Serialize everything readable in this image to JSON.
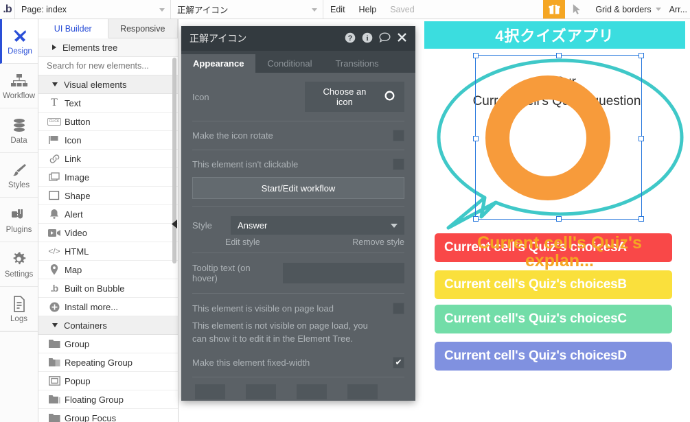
{
  "topbar": {
    "logo": "bubble-logo",
    "page_selector": "Page: index",
    "element_selector": "正解アイコン",
    "edit": "Edit",
    "help": "Help",
    "saved": "Saved",
    "gift_icon": "gift-icon",
    "cursor_icon": "cursor-arrow-icon",
    "grid_borders": "Grid & borders",
    "arrange": "Arr..."
  },
  "rail": {
    "items": [
      {
        "label": "Design",
        "icon": "design-icon",
        "active": true
      },
      {
        "label": "Workflow",
        "icon": "workflow-icon",
        "active": false
      },
      {
        "label": "Data",
        "icon": "database-icon",
        "active": false
      },
      {
        "label": "Styles",
        "icon": "brush-icon",
        "active": false
      },
      {
        "label": "Plugins",
        "icon": "plug-icon",
        "active": false
      },
      {
        "label": "Settings",
        "icon": "gear-icon",
        "active": false
      },
      {
        "label": "Logs",
        "icon": "document-icon",
        "active": false
      }
    ]
  },
  "elements_panel": {
    "tabs": [
      {
        "label": "UI Builder",
        "active": true
      },
      {
        "label": "Responsive",
        "active": false
      }
    ],
    "elements_tree": "Elements tree",
    "search_placeholder": "Search for new elements...",
    "search_value": "",
    "groups": [
      {
        "label": "Visual elements",
        "items": [
          {
            "label": "Text",
            "icon": "text-icon"
          },
          {
            "label": "Button",
            "icon": "button-icon"
          },
          {
            "label": "Icon",
            "icon": "flag-icon"
          },
          {
            "label": "Link",
            "icon": "link-icon"
          },
          {
            "label": "Image",
            "icon": "image-icon"
          },
          {
            "label": "Shape",
            "icon": "shape-icon"
          },
          {
            "label": "Alert",
            "icon": "bell-icon"
          },
          {
            "label": "Video",
            "icon": "video-icon"
          },
          {
            "label": "HTML",
            "icon": "code-icon"
          },
          {
            "label": "Map",
            "icon": "map-pin-icon"
          },
          {
            "label": "Built on Bubble",
            "icon": "bubble-icon"
          },
          {
            "label": "Install more...",
            "icon": "plus-circle-icon"
          }
        ]
      },
      {
        "label": "Containers",
        "items": [
          {
            "label": "Group",
            "icon": "folder-icon"
          },
          {
            "label": "Repeating Group",
            "icon": "folders-icon"
          },
          {
            "label": "Popup",
            "icon": "popup-icon"
          },
          {
            "label": "Floating Group",
            "icon": "floating-group-icon"
          },
          {
            "label": "Group Focus",
            "icon": "group-focus-icon"
          }
        ]
      }
    ]
  },
  "property_panel": {
    "title": "正解アイコン",
    "header_icons": [
      "help-circle-icon",
      "info-circle-icon",
      "comment-icon",
      "close-icon"
    ],
    "tabs": [
      {
        "label": "Appearance",
        "active": true
      },
      {
        "label": "Conditional",
        "active": false
      },
      {
        "label": "Transitions",
        "active": false
      }
    ],
    "icon_label": "Icon",
    "choose_icon_button": "Choose an icon",
    "choose_icon_glyph": "circle-o-icon",
    "rotate_label": "Make the icon rotate",
    "rotate_checked": false,
    "not_clickable_label": "This element isn't clickable",
    "not_clickable_checked": false,
    "workflow_button": "Start/Edit workflow",
    "style_label": "Style",
    "style_value": "Answer",
    "edit_style": "Edit style",
    "remove_style": "Remove style",
    "tooltip_label": "Tooltip text (on hover)",
    "tooltip_value": "",
    "visible_label": "This element is visible on page load",
    "visible_checked": false,
    "visible_note": "This element is not visible on page load, you can show it to edit it in the Element Tree.",
    "fixed_width_label": "Make this element fixed-width",
    "fixed_width_checked": true
  },
  "canvas": {
    "app_title": "4択クイズアプリ",
    "header_color": "#3BDDDF",
    "bubble_stroke": "#3FC8C8",
    "question_prefix": "Q. Cur",
    "question_text": "Current cell's Quiz's question",
    "ring_color": "#F79B3B",
    "ring_icon": "circle-o-icon",
    "explanation_text": "Current cell's Quiz's explan...",
    "explanation_color": "#F5A623",
    "choices": [
      {
        "label": "Current cell's Quiz's choicesA",
        "color": "#F94848"
      },
      {
        "label": "Current cell's Quiz's choicesB",
        "color": "#FAE03C"
      },
      {
        "label": "Current cell's Quiz's choicesC",
        "color": "#72DDA8"
      },
      {
        "label": "Current cell's Quiz's choicesD",
        "color": "#8091E0"
      }
    ],
    "selection": {
      "color": "#2878dd"
    }
  }
}
